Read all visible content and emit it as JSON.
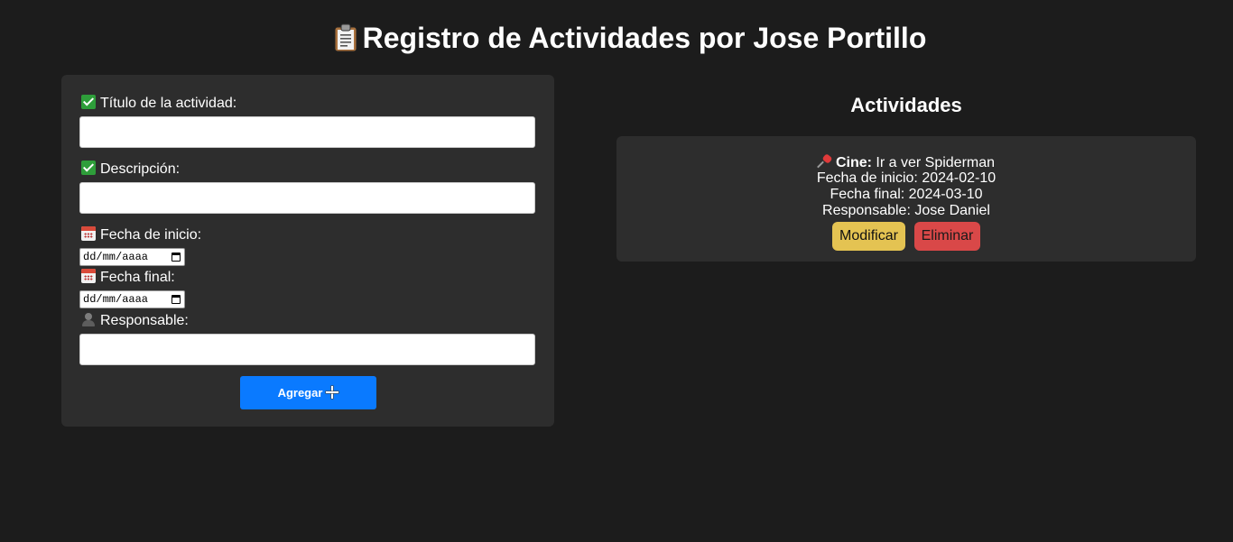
{
  "header": {
    "title": "Registro de Actividades por Jose Portillo",
    "title_icon": "clipboard-icon"
  },
  "form": {
    "title_label": "Título de la actividad:",
    "title_value": "",
    "description_label": "Descripción:",
    "description_value": "",
    "start_date_label": "Fecha de inicio:",
    "start_date_placeholder": "dd/mm/aaaa",
    "end_date_label": "Fecha final:",
    "end_date_placeholder": "dd/mm/aaaa",
    "responsible_label": "Responsable:",
    "responsible_value": "",
    "add_button_label": "Agregar"
  },
  "activities": {
    "heading": "Actividades",
    "items": [
      {
        "title": "Cine:",
        "description": "Ir a ver Spiderman",
        "start_date_text": "Fecha de inicio: 2024-02-10",
        "end_date_text": "Fecha final: 2024-03-10",
        "responsible_text": "Responsable: Jose Daniel",
        "modify_label": "Modificar",
        "delete_label": "Eliminar"
      }
    ]
  },
  "colors": {
    "background": "#1c1c1c",
    "panel": "#2d2d2d",
    "primary_button": "#0a7aff",
    "modify_button": "#e4c352",
    "delete_button": "#d94848"
  }
}
